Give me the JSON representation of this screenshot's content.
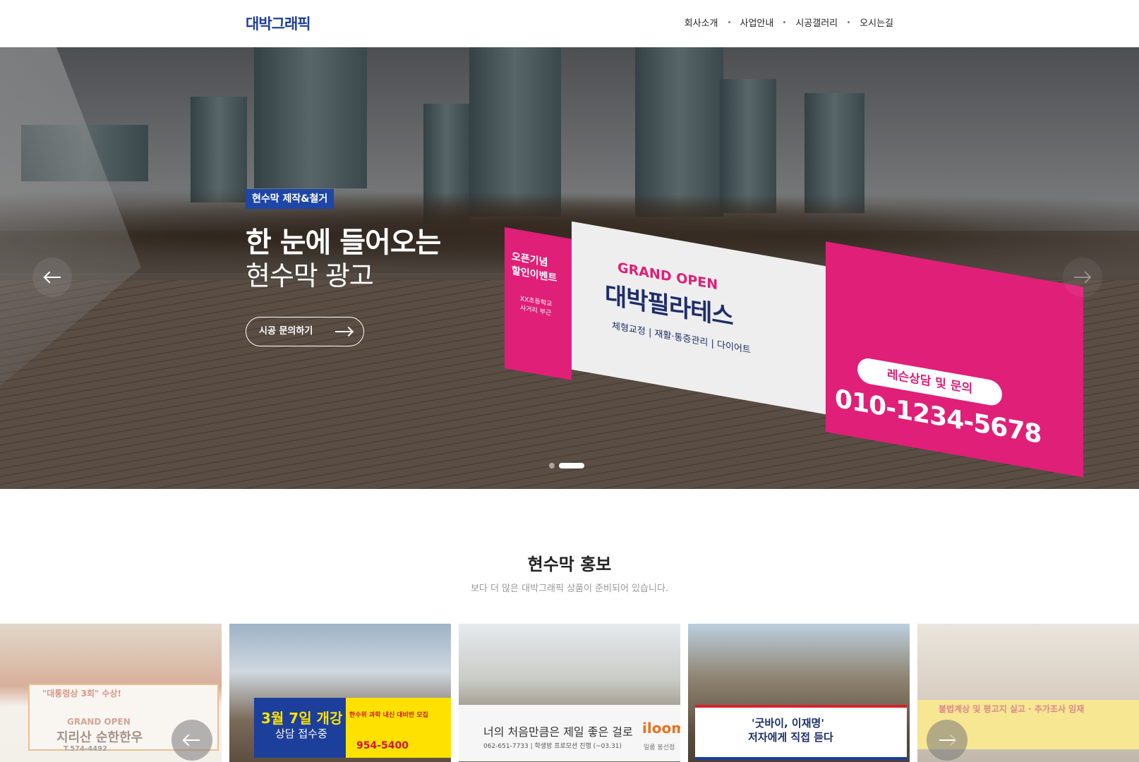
{
  "header": {
    "logo": "대박그래픽",
    "nav": [
      "회사소개",
      "사업안내",
      "시공갤러리",
      "오시는길"
    ]
  },
  "hero": {
    "badge": "현수막 제작&철거",
    "line1": "한 눈에 들어오는",
    "line2": "현수막 광고",
    "cta": "시공 문의하기",
    "banner": {
      "left_text_1": "오픈기념",
      "left_text_2": "할인이벤트",
      "left_small_1": "XX초등학교",
      "left_small_2": "사거리 부근",
      "grand_open": "GRAND OPEN",
      "name": "대박필라테스",
      "sub": "체형교정 | 재활·통증관리 | 다이어트",
      "pill": "레슨상담 및 문의",
      "phone": "010-1234-5678"
    },
    "slides_total": 2,
    "slide_active": 2
  },
  "section": {
    "title": "현수막 홍보",
    "subtitle": "보다 더 많은 대박그래픽 상품이 준비되어 있습니다."
  },
  "gallery": {
    "cards": [
      {
        "line1": "\"대통령상 3회\" 수상!",
        "line2": "GRAND OPEN",
        "line3": "지리산 순한한우",
        "line4": "T.574-4492"
      },
      {
        "line1": "3월 7일 개강",
        "line2": "상담 접수중",
        "line3": "한수위 과학 내신 대비반 모집",
        "line4": "954-5400"
      },
      {
        "line1": "너의 처음만큼은 제일 좋은 걸로",
        "line2": "iloom",
        "line3": "062-651-7733 | 학생방 프로모션 진행 (~03.31)",
        "line4": "일룸 봉선점"
      },
      {
        "line1": "'굿바이, 이재명'",
        "line2": "저자에게 직접 듣다"
      },
      {
        "line1": "불법계상 및 평고지 실고 · 추가조사 임재"
      }
    ]
  },
  "colors": {
    "brand": "#1f3f9e",
    "badge": "#1d46a6",
    "banner_pink": "#e01f78"
  }
}
